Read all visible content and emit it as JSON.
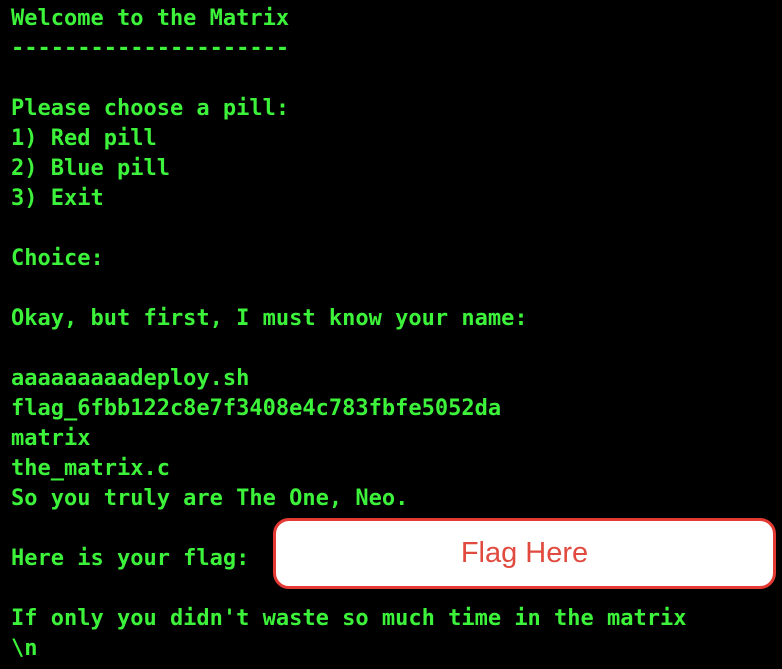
{
  "terminal": {
    "lines": {
      "welcome": "Welcome to the Matrix",
      "rule": "---------------------",
      "prompt_pill": "Please choose a pill:",
      "option_1": "1) Red pill",
      "option_2": "2) Blue pill",
      "option_3": "3) Exit",
      "choice": "Choice:",
      "name_prompt": "Okay, but first, I must know your name:",
      "ls_1": "aaaaaaaaadeploy.sh",
      "ls_2": "flag_6fbb122c8e7f3408e4c783fbfe5052da",
      "ls_3": "matrix",
      "ls_4": "the_matrix.c",
      "the_one": "So you truly are The One, Neo.",
      "flag_line": "Here is your flag:",
      "waste": "If only you didn't waste so much time in the matrix",
      "newline_literal": "\\n"
    },
    "colors": {
      "background": "#000000",
      "text": "#3df23a",
      "overlay_border": "#e53a33",
      "overlay_text": "#e04a3f"
    }
  },
  "overlay": {
    "label": "Flag Here"
  }
}
